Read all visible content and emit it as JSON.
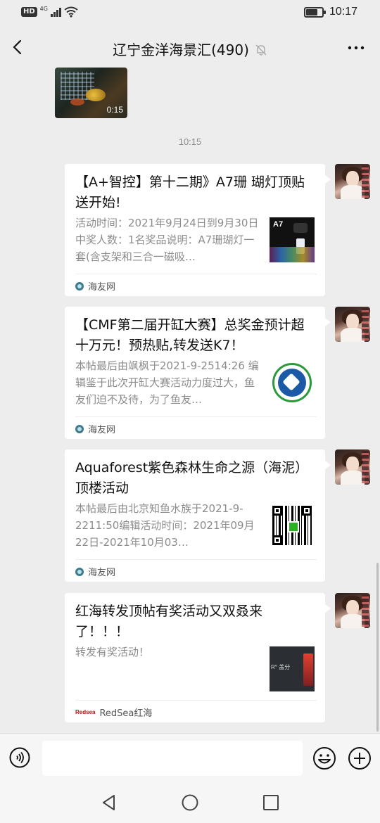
{
  "status_bar": {
    "hd_label": "HD",
    "network_label": "4G",
    "time": "10:17"
  },
  "header": {
    "title": "辽宁金洋海景汇(490)",
    "icons": {
      "back": "chevron-left-icon",
      "mute": "bell-off-icon",
      "more": "more-horizontal-icon"
    }
  },
  "chat": {
    "video": {
      "duration": "0:15"
    },
    "timestamp": "10:15",
    "messages": [
      {
        "title": "【A+智控】第十二期》A7珊 瑚灯顶贴送开始!",
        "desc": "活动时间：2021年9月24日到9月30日中奖人数：1名奖品说明：A7珊瑚灯一套(含支架和三合一磁吸…",
        "thumb_label": "A7",
        "source": "海友网"
      },
      {
        "title": "【CMF第二届开缸大赛】总奖金预计超十万元！预热贴,转发送K7！",
        "desc": "本帖最后由飒枫于2021-9-2514:26 编辑鉴于此次开缸大赛活动力度过大，鱼友们迫不及待，为了鱼友…",
        "source": "海友网"
      },
      {
        "title": "Aquaforest紫色森林生命之源（海泥）顶楼活动",
        "desc": "本帖最后由北京知鱼水族于2021-9-2211:50编辑活动时间：2021年09月22日-2021年10月03…",
        "source": "海友网"
      },
      {
        "title": "红海转发顶帖有奖活动又双叒来了！！！",
        "desc": "转发有奖活动！",
        "thumb_label": "R° 盖分",
        "source_icon_label": "Redsea",
        "source": "RedSea红海"
      }
    ]
  },
  "input_bar": {
    "value": "",
    "icons": {
      "voice": "voice-icon",
      "emoji": "emoji-icon",
      "plus": "plus-circle-icon"
    }
  },
  "nav_bar": {
    "icons": {
      "back": "triangle-back-icon",
      "home": "circle-home-icon",
      "recent": "square-recent-icon"
    }
  },
  "colors": {
    "background": "#ededed",
    "card": "#ffffff",
    "desc_text": "#8c8c8c",
    "source_icon": "#3c7a8c"
  }
}
